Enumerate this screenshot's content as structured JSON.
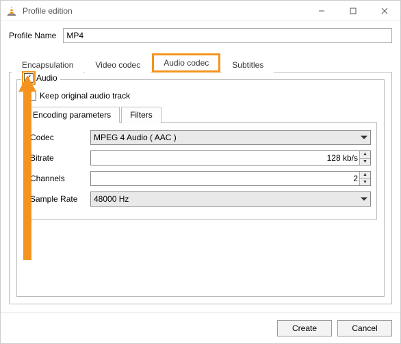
{
  "window": {
    "title": "Profile edition"
  },
  "profile": {
    "label": "Profile Name",
    "value": "MP4"
  },
  "tabs": {
    "encapsulation": "Encapsulation",
    "video": "Video codec",
    "audio": "Audio codec",
    "subtitles": "Subtitles"
  },
  "audio": {
    "group_label": "Audio",
    "keep_original": "Keep original audio track",
    "subtabs": {
      "encoding": "Encoding parameters",
      "filters": "Filters"
    },
    "fields": {
      "codec": {
        "label": "Codec",
        "value": "MPEG 4 Audio ( AAC )"
      },
      "bitrate": {
        "label": "Bitrate",
        "value": "128 kb/s"
      },
      "channels": {
        "label": "Channels",
        "value": "2"
      },
      "sample_rate": {
        "label": "Sample Rate",
        "value": "48000 Hz"
      }
    }
  },
  "buttons": {
    "create": "Create",
    "cancel": "Cancel"
  }
}
